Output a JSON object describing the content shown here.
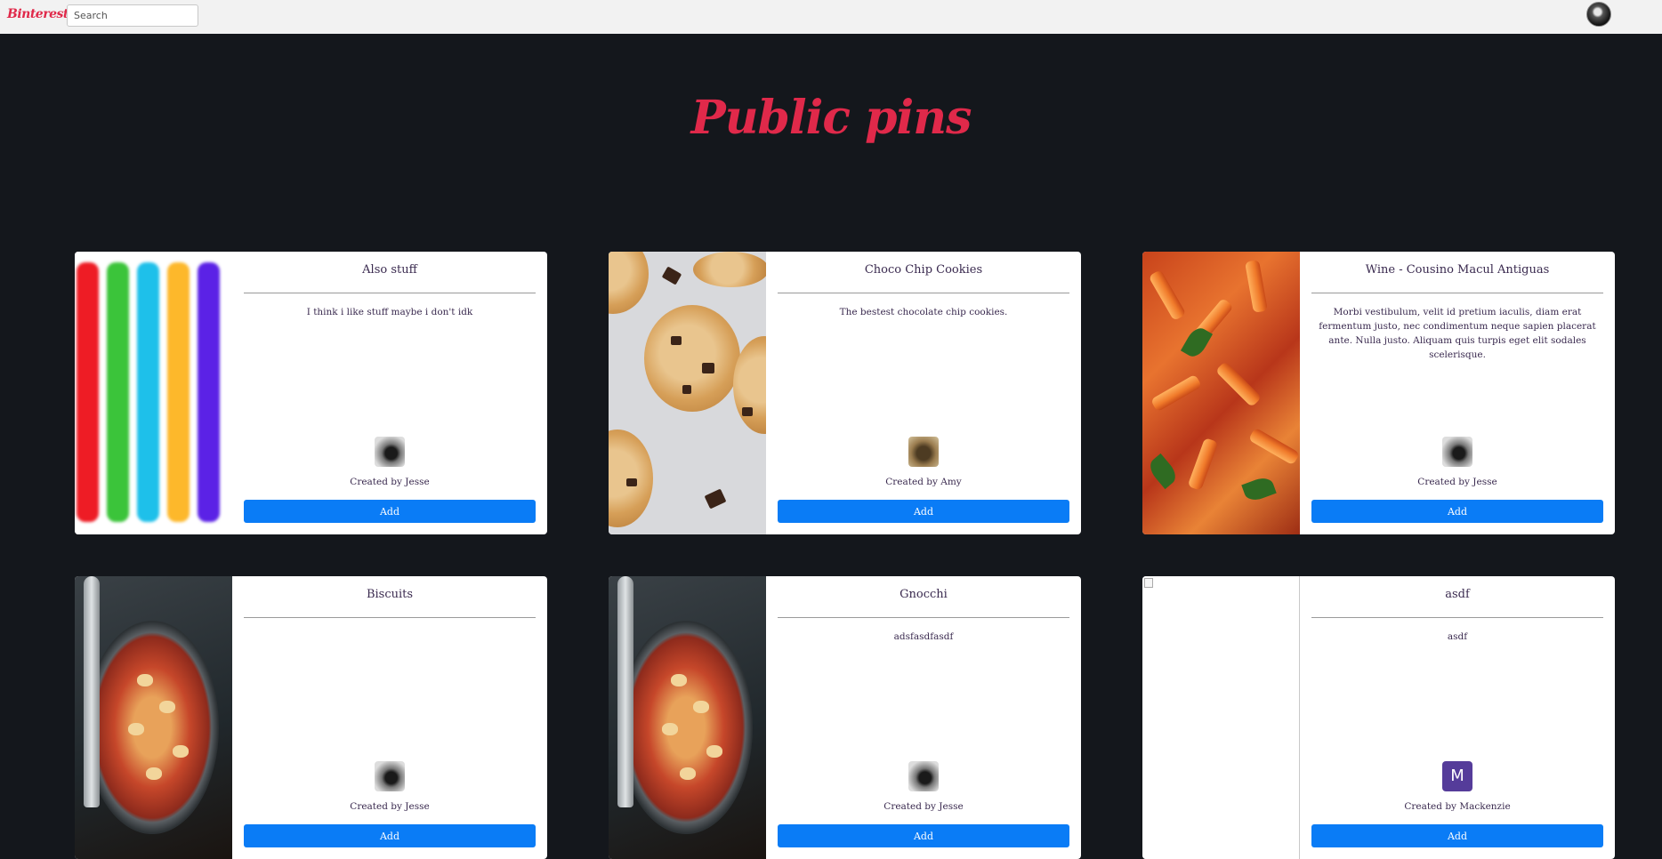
{
  "app": {
    "logo": "Binterest",
    "search_placeholder": "Search"
  },
  "page": {
    "title": "Public pins"
  },
  "pins": [
    {
      "title": "Also stuff",
      "description": "I think i like stuff maybe i don't idk",
      "creator": "Created by Jesse",
      "button": "Add"
    },
    {
      "title": "Choco Chip Cookies",
      "description": "The bestest chocolate chip cookies.",
      "creator": "Created by Amy",
      "button": "Add"
    },
    {
      "title": "Wine - Cousino Macul Antiguas",
      "description": "Morbi vestibulum, velit id pretium iaculis, diam erat fermentum justo, nec condimentum neque sapien placerat ante. Nulla justo. Aliquam quis turpis eget elit sodales scelerisque.",
      "creator": "Created by Jesse",
      "button": "Add"
    },
    {
      "title": "Biscuits",
      "description": "",
      "creator": "Created by Jesse",
      "button": "Add"
    },
    {
      "title": "Gnocchi",
      "description": "adsfasdfasdf",
      "creator": "Created by Jesse",
      "button": "Add"
    },
    {
      "title": "asdf",
      "description": "asdf",
      "creator": "Created by Mackenzie",
      "avatar_letter": "M",
      "button": "Add"
    }
  ],
  "colors": {
    "brand": "#e0294a",
    "button": "#0a7cf6",
    "background": "#14171c",
    "avatar_m": "#553c9a"
  }
}
